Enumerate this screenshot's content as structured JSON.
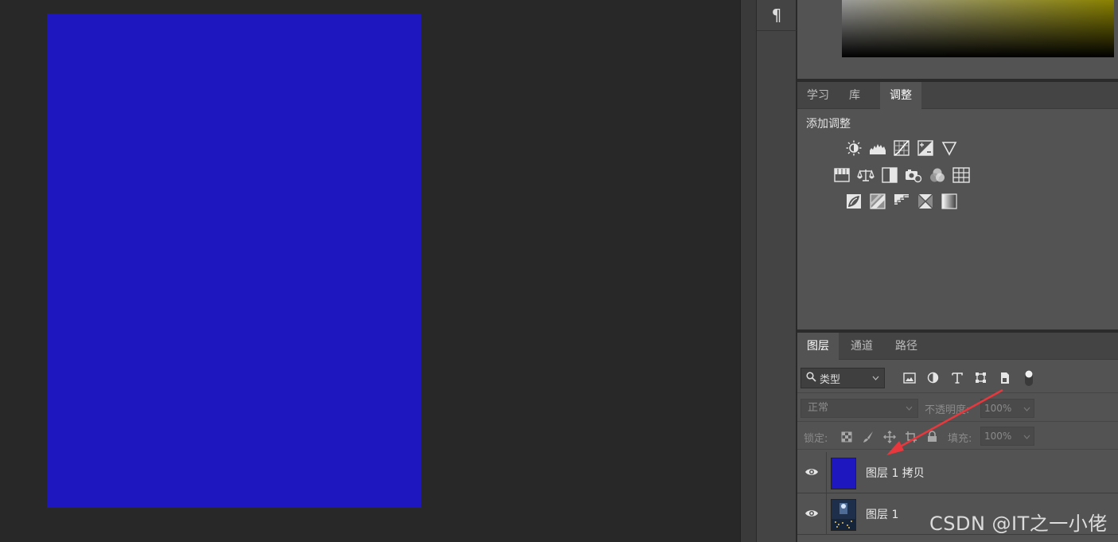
{
  "canvas": {
    "document_color": "#1e17c0"
  },
  "side_strip": {
    "paragraph_icon": "¶"
  },
  "color_panel": {
    "gradient_hue": "#8a8200"
  },
  "adjust_panel": {
    "tabs": [
      {
        "label": "学习"
      },
      {
        "label": "库"
      },
      {
        "label": "调整"
      }
    ],
    "add_adjustment_label": "添加调整",
    "icon_rows": [
      [
        "brightness-icon",
        "levels-icon",
        "curves-icon",
        "exposure-icon",
        "vibrance-icon"
      ],
      [
        "hue-saturation-icon",
        "color-balance-icon",
        "black-white-icon",
        "photo-filter-icon",
        "channel-mixer-icon",
        "color-lookup-icon"
      ],
      [
        "invert-icon",
        "posterize-icon",
        "threshold-icon",
        "selective-color-icon",
        "gradient-map-icon"
      ]
    ]
  },
  "layers_panel": {
    "tabs": [
      {
        "label": "图层"
      },
      {
        "label": "通道"
      },
      {
        "label": "路径"
      }
    ],
    "filter": {
      "selected": "类型"
    },
    "blend_mode": "正常",
    "opacity_label": "不透明度:",
    "opacity_value": "100%",
    "lock_label": "锁定:",
    "fill_label": "填充:",
    "fill_value": "100%",
    "layers": [
      {
        "name": "图层 1 拷贝",
        "thumb_color": "#1e17c0"
      },
      {
        "name": "图层 1",
        "thumb_color": "#1d2f4a"
      }
    ]
  },
  "watermark": "CSDN @IT之一小佬",
  "annotation_color": "#e8383d"
}
